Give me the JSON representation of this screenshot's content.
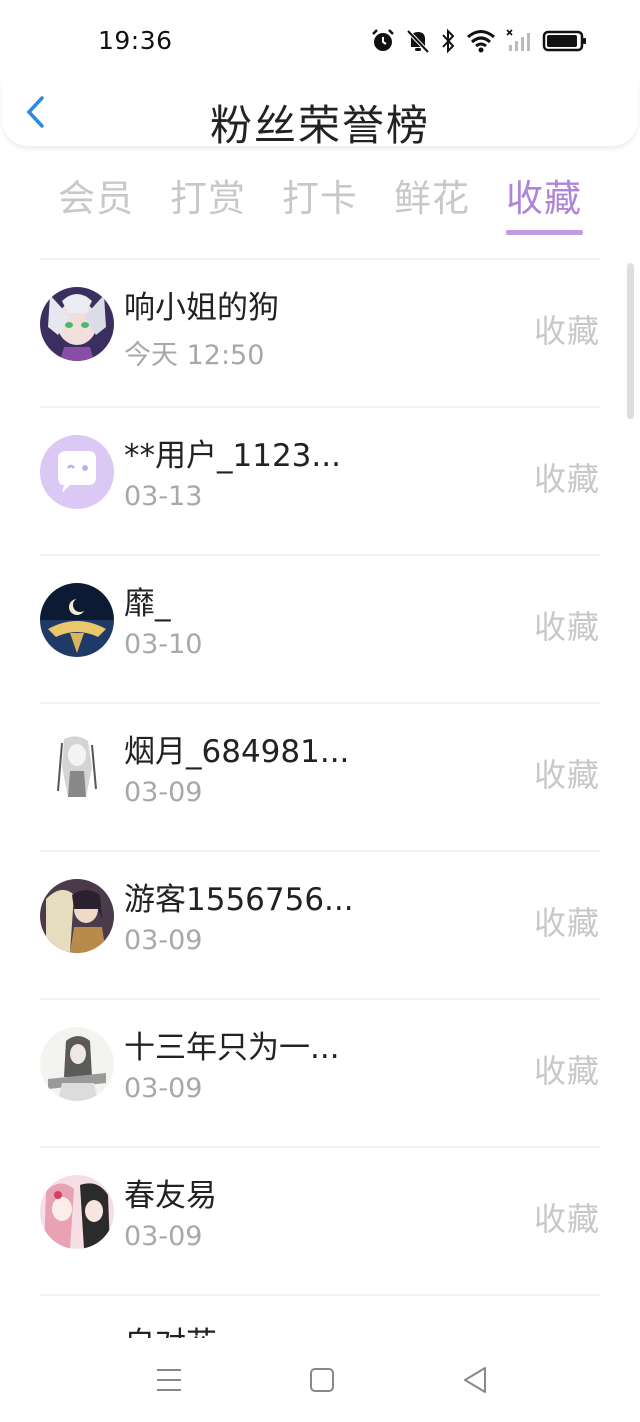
{
  "status_bar": {
    "time": "19:36",
    "icons": [
      "alarm-icon",
      "mute-icon",
      "bluetooth-icon",
      "wifi-icon",
      "cellular-signal-icon",
      "battery-icon"
    ]
  },
  "header": {
    "back_icon": "chevron-left-icon",
    "title": "粉丝荣誉榜"
  },
  "tabs": [
    {
      "label": "会员",
      "active": false
    },
    {
      "label": "打赏",
      "active": false
    },
    {
      "label": "打卡",
      "active": false
    },
    {
      "label": "鲜花",
      "active": false
    },
    {
      "label": "收藏",
      "active": true
    }
  ],
  "list": [
    {
      "name": "响小姐的狗",
      "date": "今天 12:50",
      "action": "收藏"
    },
    {
      "name": "**用户_1123...",
      "date": "03-13",
      "action": "收藏"
    },
    {
      "name": "靡_",
      "date": "03-10",
      "action": "收藏"
    },
    {
      "name": "烟月_684981...",
      "date": "03-09",
      "action": "收藏"
    },
    {
      "name": "游客1556756...",
      "date": "03-09",
      "action": "收藏"
    },
    {
      "name": "十三年只为一...",
      "date": "03-09",
      "action": "收藏"
    },
    {
      "name": "春友易",
      "date": "03-09",
      "action": "收藏"
    },
    {
      "name": "自对花",
      "date": "",
      "action": ""
    }
  ],
  "nav_bar": {
    "icons": [
      "menu-icon",
      "home-square-icon",
      "back-triangle-icon"
    ]
  },
  "colors": {
    "accent": "#b084d8",
    "inactive_tab": "#c8c8c8",
    "back_arrow": "#2a8ae0"
  }
}
